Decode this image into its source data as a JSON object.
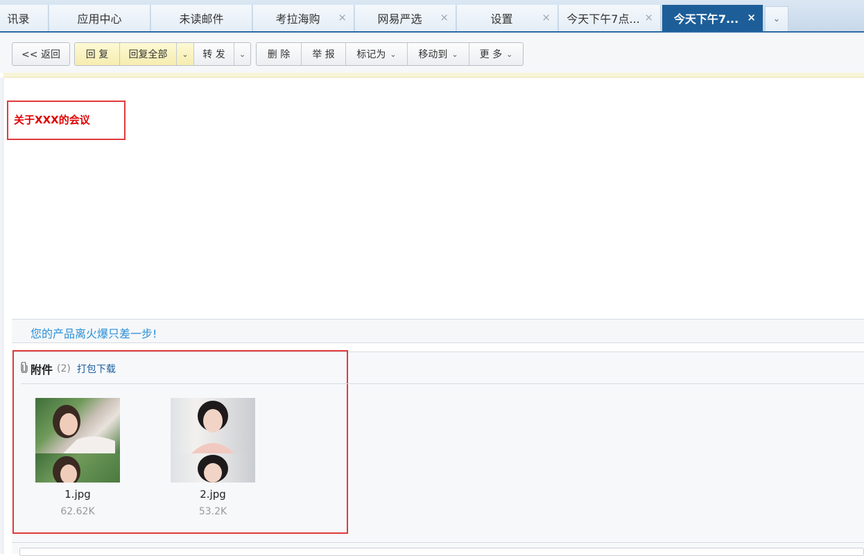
{
  "tabs": [
    {
      "label": "讯录",
      "closable": false,
      "active": false
    },
    {
      "label": "应用中心",
      "closable": false,
      "active": false
    },
    {
      "label": "未读邮件",
      "closable": false,
      "active": false
    },
    {
      "label": "考拉海购",
      "closable": true,
      "active": false
    },
    {
      "label": "网易严选",
      "closable": true,
      "active": false
    },
    {
      "label": "设置",
      "closable": true,
      "active": false
    },
    {
      "label": "今天下午7点...",
      "closable": true,
      "active": false
    },
    {
      "label": "今天下午7...",
      "closable": true,
      "active": true
    }
  ],
  "tab_close_glyph": "×",
  "tab_more_glyph": "⌄",
  "toolbar": {
    "back": "<< 返回",
    "reply": "回 复",
    "reply_all": "回复全部",
    "forward": "转 发",
    "delete": "删 除",
    "report": "举 报",
    "mark_as": "标记为",
    "move_to": "移动到",
    "more": "更 多",
    "dropdown_glyph": "⌄"
  },
  "message": {
    "body_text": "关于XXX的会议"
  },
  "ad": {
    "link_text": "您的产品离火爆只差一步!"
  },
  "attachments": {
    "title": "附件",
    "count": "(2)",
    "download_all": "打包下载",
    "files": [
      {
        "name": "1.jpg",
        "size": "62.62K"
      },
      {
        "name": "2.jpg",
        "size": "53.2K"
      }
    ]
  },
  "colors": {
    "accent_tab": "#1d5e99",
    "highlight_border": "#e03a3a",
    "body_text": "#e00000",
    "link": "#2a8fd8"
  }
}
